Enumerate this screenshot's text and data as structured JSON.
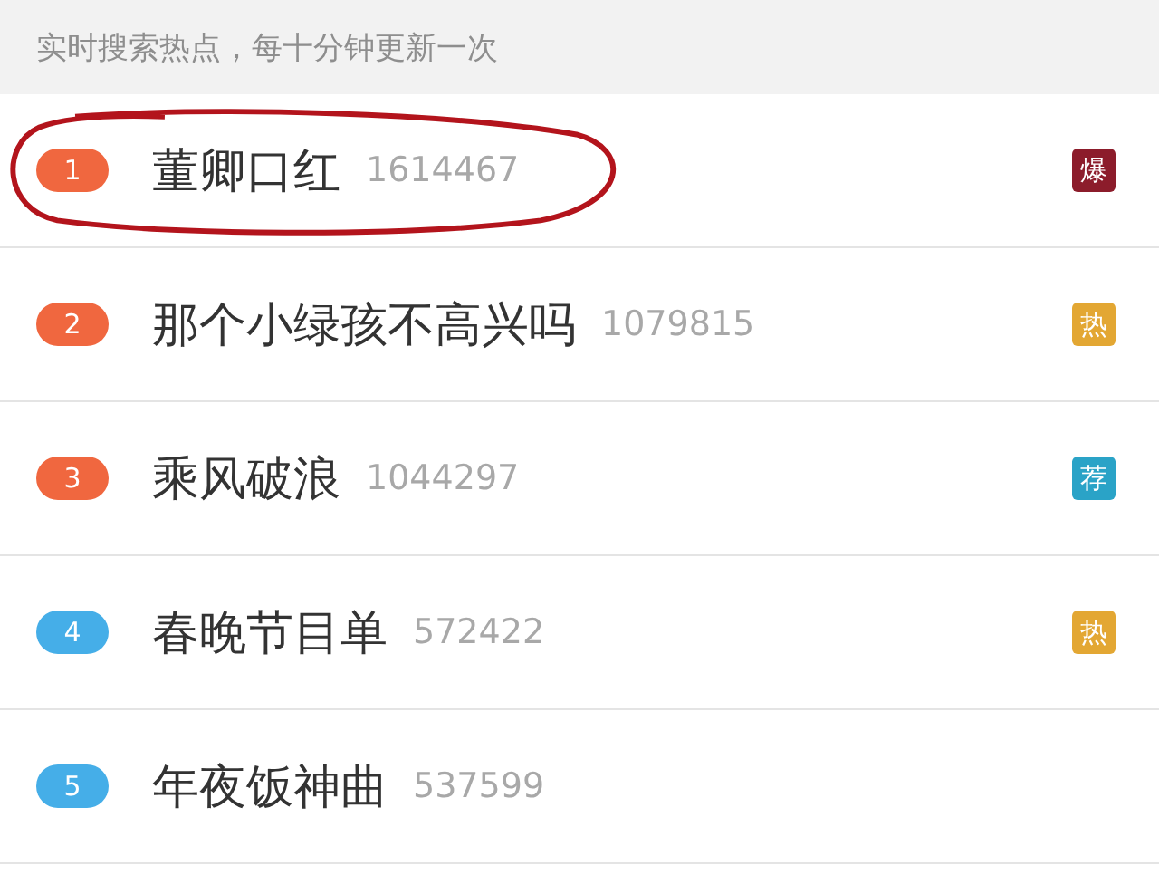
{
  "header": {
    "text": "实时搜索热点，每十分钟更新一次"
  },
  "items": [
    {
      "rank": "1",
      "color": "#f0673f",
      "title": "董卿口红",
      "count": "1614467",
      "tag": {
        "text": "爆",
        "color": "#8c1c2b"
      },
      "circled": true
    },
    {
      "rank": "2",
      "color": "#f0673f",
      "title": "那个小绿孩不高兴吗",
      "count": "1079815",
      "tag": {
        "text": "热",
        "color": "#e3a733"
      },
      "circled": false
    },
    {
      "rank": "3",
      "color": "#f0673f",
      "title": "乘风破浪",
      "count": "1044297",
      "tag": {
        "text": "荐",
        "color": "#2aa3c7"
      },
      "circled": false
    },
    {
      "rank": "4",
      "color": "#45aee8",
      "title": "春晚节目单",
      "count": "572422",
      "tag": {
        "text": "热",
        "color": "#e3a733"
      },
      "circled": false
    },
    {
      "rank": "5",
      "color": "#45aee8",
      "title": "年夜饭神曲",
      "count": "537599",
      "circled": false
    }
  ]
}
